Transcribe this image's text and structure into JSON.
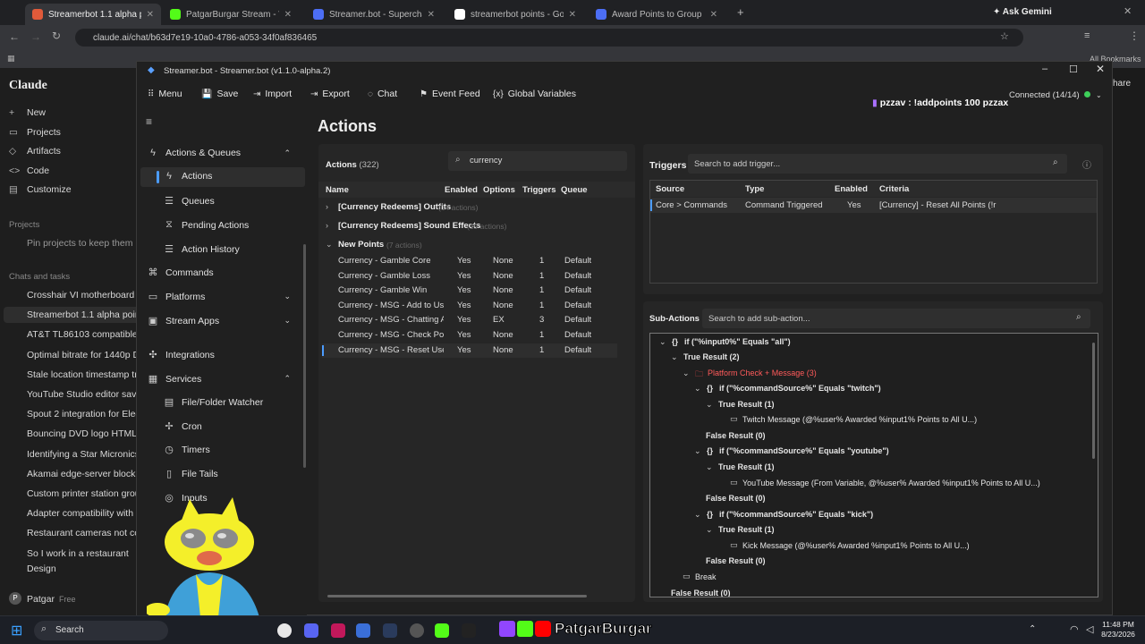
{
  "browser": {
    "tabs": [
      {
        "label": "Streamerbot 1.1 alpha points",
        "color": "#e05a3a",
        "active": true
      },
      {
        "label": "PatgarBurgar Stream - Watch L",
        "color": "#53fc18"
      },
      {
        "label": "Streamer.bot - Supercharge yo",
        "color": "#4c6ef5"
      },
      {
        "label": "streamerbot points - Google Se",
        "color": "#ffffff"
      },
      {
        "label": "Award Points to Group | Stream",
        "color": "#4c6ef5"
      }
    ],
    "new_tab": "+",
    "ask_gemini": "Ask Gemini",
    "url": "claude.ai/chat/b63d7e19-10a0-4786-a053-34f0af836465",
    "all_bookmarks": "All Bookmarks"
  },
  "claude": {
    "logo": "Claude",
    "menu": [
      {
        "label": "New",
        "icon": "plus-icon"
      },
      {
        "label": "Projects",
        "icon": "projects-icon"
      },
      {
        "label": "Artifacts",
        "icon": "artifacts-icon"
      },
      {
        "label": "Code",
        "icon": "code-icon"
      },
      {
        "label": "Customize",
        "icon": "customize-icon"
      }
    ],
    "projects_heading": "Projects",
    "pin_hint": "Pin projects to keep them he",
    "chats_heading": "Chats and tasks",
    "chats": [
      "Crosshair VI motherboard w",
      "Streamerbot 1.1 alpha points",
      "AT&T TL86103 compatible ha",
      "Optimal bitrate for 1440p Da",
      "Stale location timestamp tro",
      "YouTube Studio editor save a",
      "Spout 2 integration for Elect",
      "Bouncing DVD logo HTML",
      "Identifying a Star Micronics",
      "Akamai edge-server block o",
      "Custom printer station group",
      "Adapter compatibility with F",
      "Restaurant cameras not conr",
      "So I work in a restaurant"
    ],
    "design": "Design",
    "user": "Patgar",
    "plan": "Free",
    "share": "hare"
  },
  "streamerbot": {
    "window_title": "Streamer.bot - Streamer.bot (v1.1.0-alpha.2)",
    "toolbar": [
      "Menu",
      "Save",
      "Import",
      "Export",
      "Chat",
      "Event Feed",
      "Global Variables"
    ],
    "connected": "Connected (14/14)",
    "chat_overlay": "pzzav : !addpoints 100 pzzax",
    "nav": {
      "actions_queues": "Actions & Queues",
      "actions": "Actions",
      "queues": "Queues",
      "pending": "Pending Actions",
      "history": "Action History",
      "commands": "Commands",
      "platforms": "Platforms",
      "stream_apps": "Stream Apps",
      "integrations": "Integrations",
      "services": "Services",
      "file_folder": "File/Folder Watcher",
      "cron": "Cron",
      "timers": "Timers",
      "file_tails": "File Tails",
      "inputs": "Inputs"
    },
    "page_title": "Actions",
    "actions_panel": {
      "title": "Actions",
      "count": "(322)",
      "search_value": "currency",
      "columns": [
        "Name",
        "Enabled",
        "Options",
        "Triggers",
        "Queue"
      ],
      "groups": [
        {
          "name": "[Currency Redeems] Outfits",
          "count": "(14 actions)"
        },
        {
          "name": "[Currency Redeems] Sound Effects",
          "count": "(19 actions)"
        },
        {
          "name": "New Points",
          "count": "(7 actions)"
        }
      ],
      "rows": [
        [
          "Currency - Gamble Core",
          "Yes",
          "None",
          "1",
          "Default"
        ],
        [
          "Currency - Gamble Loss",
          "Yes",
          "None",
          "1",
          "Default"
        ],
        [
          "Currency - Gamble Win",
          "Yes",
          "None",
          "1",
          "Default"
        ],
        [
          "Currency - MSG - Add to Us",
          "Yes",
          "None",
          "1",
          "Default"
        ],
        [
          "Currency - MSG - Chatting A",
          "Yes",
          "EX",
          "3",
          "Default"
        ],
        [
          "Currency - MSG - Check Poi",
          "Yes",
          "None",
          "1",
          "Default"
        ],
        [
          "Currency - MSG - Reset Use",
          "Yes",
          "None",
          "1",
          "Default"
        ]
      ]
    },
    "triggers_panel": {
      "title": "Triggers",
      "search_placeholder": "Search to add trigger...",
      "columns": [
        "Source",
        "Type",
        "Enabled",
        "Criteria"
      ],
      "row": [
        "Core > Commands",
        "Command Triggered",
        "Yes",
        "[Currency] - Reset All Points (!r"
      ]
    },
    "subactions_panel": {
      "title": "Sub-Actions",
      "search_placeholder": "Search to add sub-action...",
      "lines": [
        {
          "text": "if (\"%input0%\" Equals \"all\")",
          "indent": 0,
          "bold": true,
          "icon": "{}",
          "chev": "v"
        },
        {
          "text": "True Result (2)",
          "indent": 1,
          "bold": true,
          "chev": "v"
        },
        {
          "text": "Platform Check + Message (3)",
          "indent": 2,
          "red": true,
          "icon": "folder",
          "chev": "v"
        },
        {
          "text": "if (\"%commandSource%\" Equals \"twitch\")",
          "indent": 3,
          "bold": true,
          "icon": "{}",
          "chev": "v"
        },
        {
          "text": "True Result (1)",
          "indent": 4,
          "bold": true,
          "chev": "v"
        },
        {
          "text": "Twitch Message (@%user% Awarded %input1% Points to All U...)",
          "indent": 5,
          "icon": "msg"
        },
        {
          "text": "False Result (0)",
          "indent": 4,
          "bold": true
        },
        {
          "text": "if (\"%commandSource%\" Equals \"youtube\")",
          "indent": 3,
          "bold": true,
          "icon": "{}",
          "chev": "v"
        },
        {
          "text": "True Result (1)",
          "indent": 4,
          "bold": true,
          "chev": "v"
        },
        {
          "text": "YouTube Message (From Variable, @%user% Awarded %input1% Points to All U...)",
          "indent": 5,
          "icon": "msg"
        },
        {
          "text": "False Result (0)",
          "indent": 4,
          "bold": true
        },
        {
          "text": "if (\"%commandSource%\" Equals \"kick\")",
          "indent": 3,
          "bold": true,
          "icon": "{}",
          "chev": "v"
        },
        {
          "text": "True Result (1)",
          "indent": 4,
          "bold": true,
          "chev": "v"
        },
        {
          "text": "Kick Message (@%user% Awarded %input1% Points to All U...)",
          "indent": 5,
          "icon": "msg"
        },
        {
          "text": "False Result (0)",
          "indent": 4,
          "bold": true
        },
        {
          "text": "Break",
          "indent": 2,
          "icon": "msg"
        },
        {
          "text": "False Result (0)",
          "indent": 1,
          "bold": true
        }
      ]
    }
  },
  "taskbar": {
    "search": "Search",
    "banner": "PatgarBurgar",
    "time": "11:48 PM",
    "date": "8/23/2026"
  }
}
